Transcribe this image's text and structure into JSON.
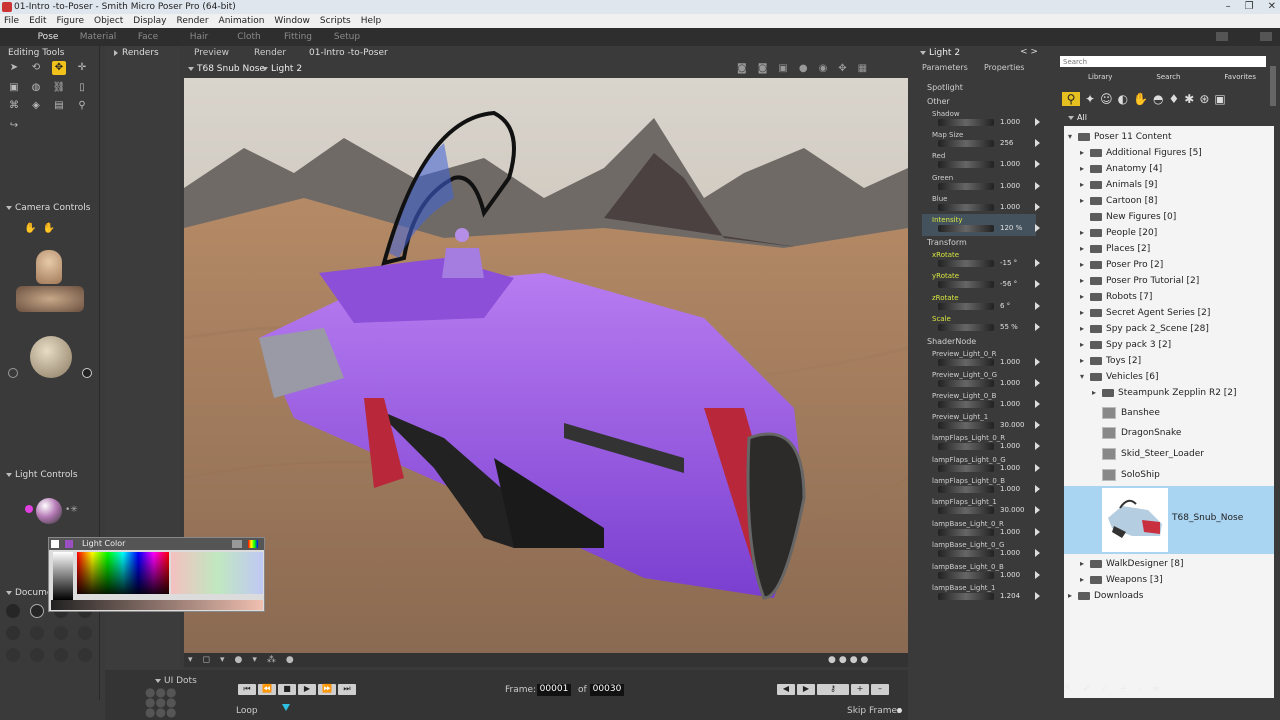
{
  "window": {
    "title": "01-Intro -to-Poser - Smith Micro Poser Pro  (64-bit)",
    "controls": [
      "–",
      "❐",
      "✕"
    ]
  },
  "menu": [
    "File",
    "Edit",
    "Figure",
    "Object",
    "Display",
    "Render",
    "Animation",
    "Window",
    "Scripts",
    "Help"
  ],
  "rooms": [
    "Pose",
    "Material",
    "Face",
    "Hair",
    "Cloth",
    "Fitting",
    "Setup"
  ],
  "left": {
    "editing_tools": "Editing Tools",
    "camera_controls": "Camera Controls",
    "light_controls": "Light Controls",
    "document": "Docume"
  },
  "renders": {
    "label": "Renders"
  },
  "viewport": {
    "tabs": [
      "Preview",
      "Render"
    ],
    "doc_name": "01-Intro -to-Poser",
    "figure_select": "T68 Snub Nose",
    "actor_select": "Light 2"
  },
  "light_color": {
    "title": "Light Color"
  },
  "timeline": {
    "frame_label": "Frame:",
    "frame_value": "00001",
    "of_label": "of",
    "total_frames": "00030",
    "loop_label": "Loop",
    "skip_frames_label": "Skip Frames",
    "ui_dots_label": "UI Dots"
  },
  "params": {
    "actor": "Light 2",
    "tabs": [
      "Parameters",
      "Properties"
    ],
    "groups": [
      "Spotlight",
      "Other",
      "Transform",
      "ShaderNode"
    ],
    "items": [
      {
        "name": "Shadow",
        "value": "1.000"
      },
      {
        "name": "Map Size",
        "value": "256"
      },
      {
        "name": "Red",
        "value": "1.000"
      },
      {
        "name": "Green",
        "value": "1.000"
      },
      {
        "name": "Blue",
        "value": "1.000"
      },
      {
        "name": "Intensity",
        "value": "120 %"
      },
      {
        "name": "xRotate",
        "value": "-15 °"
      },
      {
        "name": "yRotate",
        "value": "-56 °"
      },
      {
        "name": "zRotate",
        "value": "6 °"
      },
      {
        "name": "Scale",
        "value": "55 %"
      },
      {
        "name": "Preview_Light_0_R",
        "value": "1.000"
      },
      {
        "name": "Preview_Light_0_G",
        "value": "1.000"
      },
      {
        "name": "Preview_Light_0_B",
        "value": "1.000"
      },
      {
        "name": "Preview_Light_1",
        "value": "30.000"
      },
      {
        "name": "lampFlaps_Light_0_R",
        "value": "1.000"
      },
      {
        "name": "lampFlaps_Light_0_G",
        "value": "1.000"
      },
      {
        "name": "lampFlaps_Light_0_B",
        "value": "1.000"
      },
      {
        "name": "lampFlaps_Light_1",
        "value": "30.000"
      },
      {
        "name": "lampBase_Light_0_R",
        "value": "1.000"
      },
      {
        "name": "lampBase_Light_0_G",
        "value": "1.000"
      },
      {
        "name": "lampBase_Light_0_B",
        "value": "1.000"
      },
      {
        "name": "lampBase_Light_1",
        "value": "1.204"
      }
    ]
  },
  "library": {
    "search_placeholder": "Search",
    "tabs": [
      "Library",
      "Search",
      "Favorites"
    ],
    "filter": "All",
    "root": "Poser 11 Content",
    "folders": [
      "Additional Figures [5]",
      "Anatomy [4]",
      "Animals [9]",
      "Cartoon [8]",
      "New Figures [0]",
      "People [20]",
      "Places [2]",
      "Poser Pro [2]",
      "Poser Pro Tutorial [2]",
      "Robots [7]",
      "Secret Agent Series [2]",
      "Spy pack 2_Scene [28]",
      "Spy pack 3 [2]",
      "Toys [2]",
      "Vehicles [6]"
    ],
    "vehicles_sub": "Steampunk Zepplin R2 [2]",
    "items": [
      "Banshee",
      "DragonSnake",
      "Skid_Steer_Loader",
      "SoloShip"
    ],
    "selected_item": "T68_Snub_Nose",
    "folders_after": [
      "WalkDesigner [8]",
      "Weapons [3]"
    ],
    "downloads": "Downloads"
  }
}
